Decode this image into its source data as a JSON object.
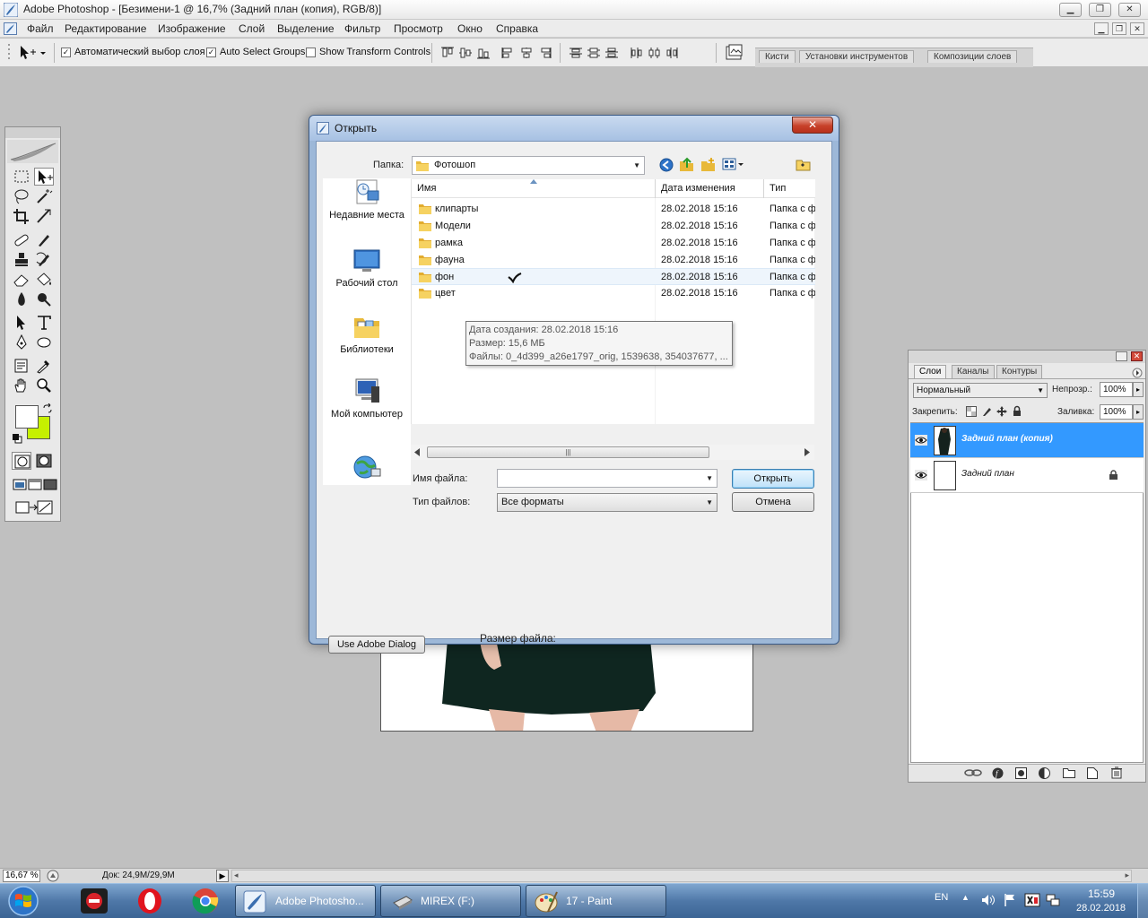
{
  "window": {
    "title": "Adobe Photoshop - [Безимени-1 @ 16,7% (Задний план (копия), RGB/8)]"
  },
  "menu": [
    "Файл",
    "Редактирование",
    "Изображение",
    "Слой",
    "Выделение",
    "Фильтр",
    "Просмотр",
    "Окно",
    "Справка"
  ],
  "options": {
    "auto_select_layer": "Автоматический выбор слоя",
    "auto_select_groups": "Auto Select Groups",
    "show_transform": "Show Transform Controls",
    "palette_tabs": [
      "Кисти",
      "Установки инструментов",
      "Композиции слоев"
    ]
  },
  "colors": {
    "foreground": "#ffffff",
    "background": "#c6f000"
  },
  "dialog": {
    "title": "Открыть",
    "folder_label": "Папка:",
    "folder_value": "Фотошоп",
    "places": [
      "Недавние места",
      "Рабочий стол",
      "Библиотеки",
      "Мой компьютер"
    ],
    "columns": [
      "Имя",
      "Дата изменения",
      "Тип"
    ],
    "files": [
      {
        "name": "клипарты",
        "date": "28.02.2018 15:16",
        "type": "Папка с ф"
      },
      {
        "name": "Модели",
        "date": "28.02.2018 15:16",
        "type": "Папка с ф"
      },
      {
        "name": "рамка",
        "date": "28.02.2018 15:16",
        "type": "Папка с ф"
      },
      {
        "name": "фауна",
        "date": "28.02.2018 15:16",
        "type": "Папка с ф"
      },
      {
        "name": "фон",
        "date": "28.02.2018 15:16",
        "type": "Папка с ф"
      },
      {
        "name": "цвет",
        "date": "28.02.2018 15:16",
        "type": "Папка с ф"
      }
    ],
    "tooltip": {
      "created": "Дата создания: 28.02.2018 15:16",
      "size": "Размер: 15,6 МБ",
      "files": "Файлы: 0_4d399_a26e1797_orig, 1539638, 354037677, ..."
    },
    "filename_label": "Имя файла:",
    "filename_value": "",
    "filetype_label": "Тип файлов:",
    "filetype_value": "Все форматы",
    "open_button": "Открыть",
    "cancel_button": "Отмена",
    "adobe_dialog_button": "Use Adobe Dialog",
    "file_size_label": "Размер файла:"
  },
  "layers": {
    "tabs": [
      "Слои",
      "Каналы",
      "Контуры"
    ],
    "blend_mode": "Нормальный",
    "opacity_label": "Непрозр.:",
    "opacity_value": "100%",
    "lock_label": "Закрепить:",
    "fill_label": "Заливка:",
    "fill_value": "100%",
    "items": [
      {
        "name": "Задний план (копия)",
        "selected": true
      },
      {
        "name": "Задний план",
        "selected": false
      }
    ]
  },
  "status": {
    "zoom": "16,67 %",
    "doc": "Док: 24,9M/29,9M"
  },
  "taskbar": {
    "tasks": [
      "Adobe Photosho...",
      "MIREX (F:)",
      "17 - Paint"
    ],
    "lang": "EN",
    "time": "15:59",
    "date": "28.02.2018"
  }
}
